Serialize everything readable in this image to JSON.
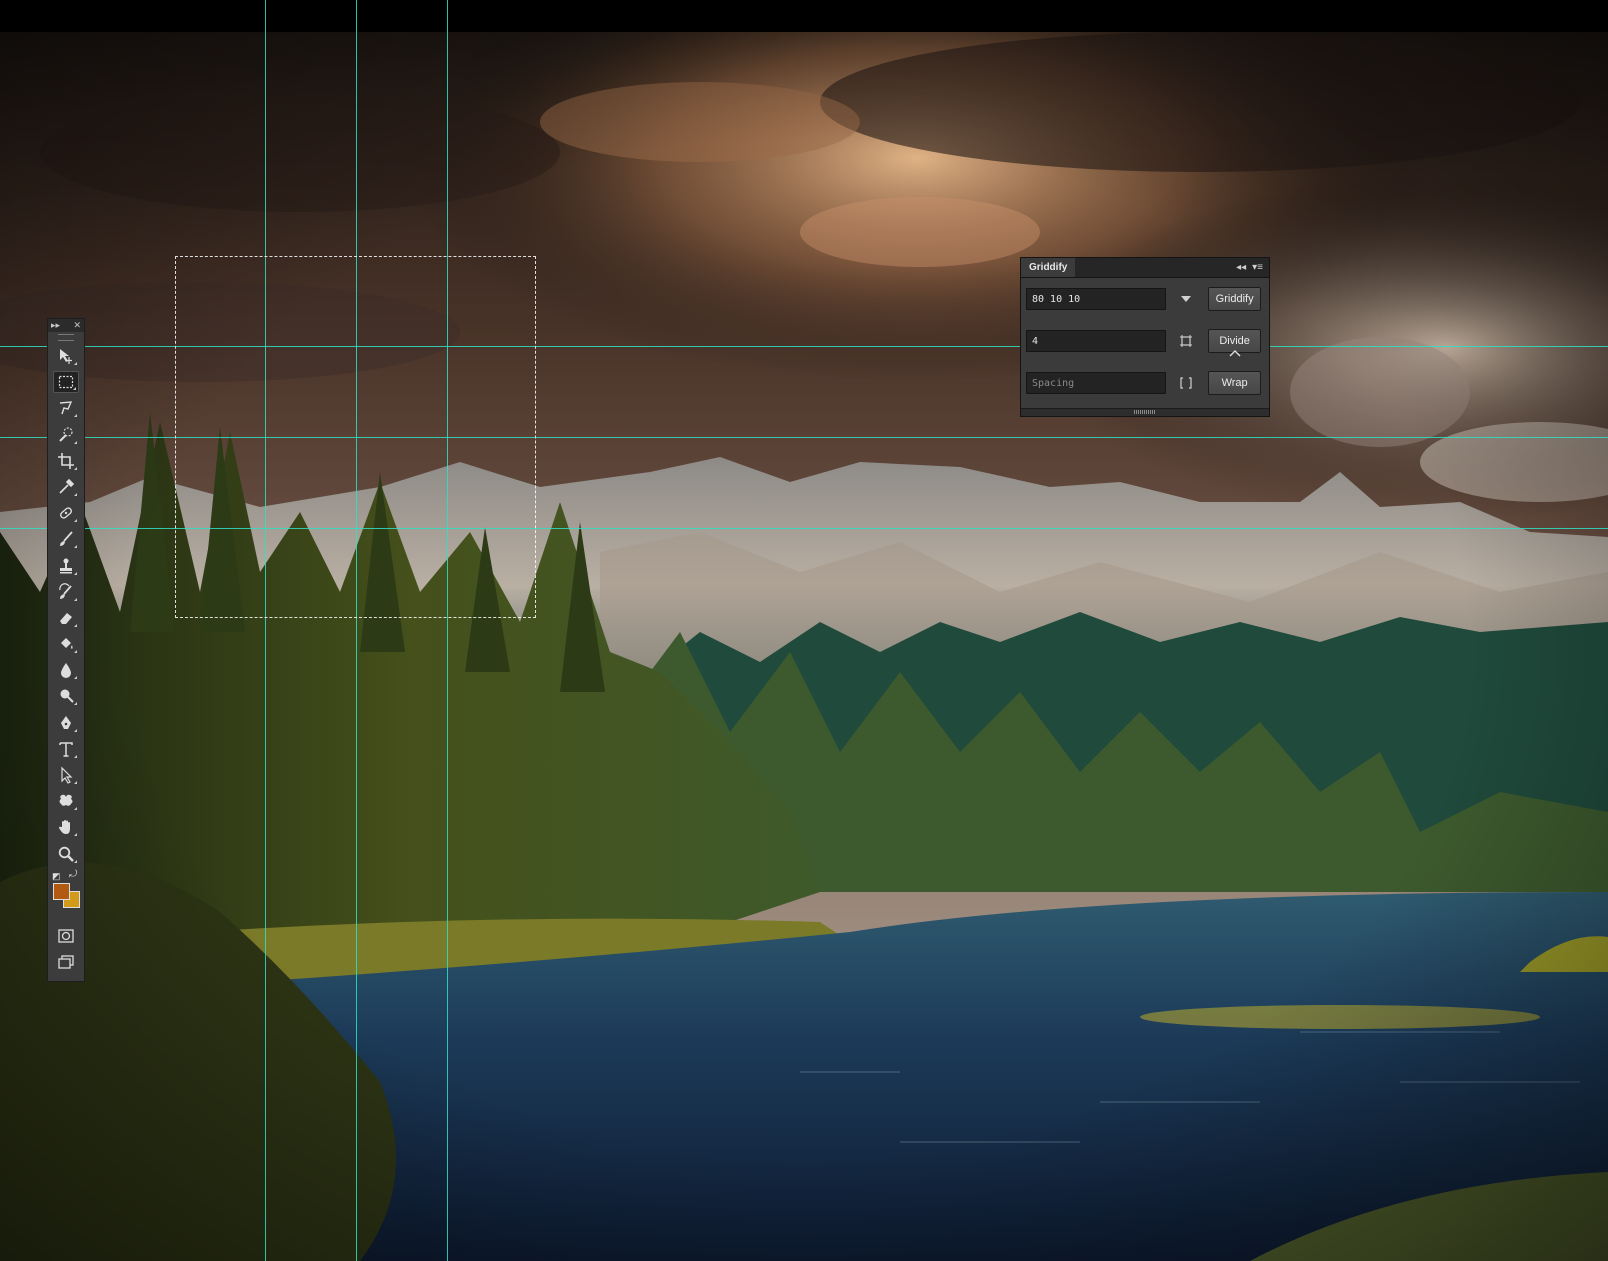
{
  "window": {
    "background": "#000000"
  },
  "guides": {
    "color": "#2fe0c4"
  },
  "tools_panel": {
    "collapse_glyph": "▸▸",
    "close_glyph": "✕",
    "tools": [
      {
        "name": "move-tool-icon"
      },
      {
        "name": "rectangular-marquee-tool-icon",
        "active": true
      },
      {
        "name": "lasso-tool-icon"
      },
      {
        "name": "quick-selection-tool-icon"
      },
      {
        "name": "crop-tool-icon"
      },
      {
        "name": "eyedropper-tool-icon"
      },
      {
        "name": "spot-healing-brush-tool-icon"
      },
      {
        "name": "brush-tool-icon"
      },
      {
        "name": "clone-stamp-tool-icon"
      },
      {
        "name": "history-brush-tool-icon"
      },
      {
        "name": "eraser-tool-icon"
      },
      {
        "name": "paint-bucket-tool-icon"
      },
      {
        "name": "blur-tool-icon"
      },
      {
        "name": "dodge-tool-icon"
      },
      {
        "name": "pen-tool-icon"
      },
      {
        "name": "type-tool-icon"
      },
      {
        "name": "path-selection-tool-icon"
      },
      {
        "name": "custom-shape-tool-icon"
      },
      {
        "name": "hand-tool-icon"
      },
      {
        "name": "zoom-tool-icon"
      }
    ],
    "foreground_color": "#b25a12",
    "background_color": "#d19a18"
  },
  "griddify": {
    "title": "Griddify",
    "collapse_glyph": "◂◂",
    "menu_glyph": "▾≡",
    "guides_input_value": "80 10 10",
    "guides_button": "Griddify",
    "divide_input_value": "4",
    "divide_button": "Divide",
    "spacing_placeholder": "Spacing",
    "wrap_button": "Wrap"
  }
}
